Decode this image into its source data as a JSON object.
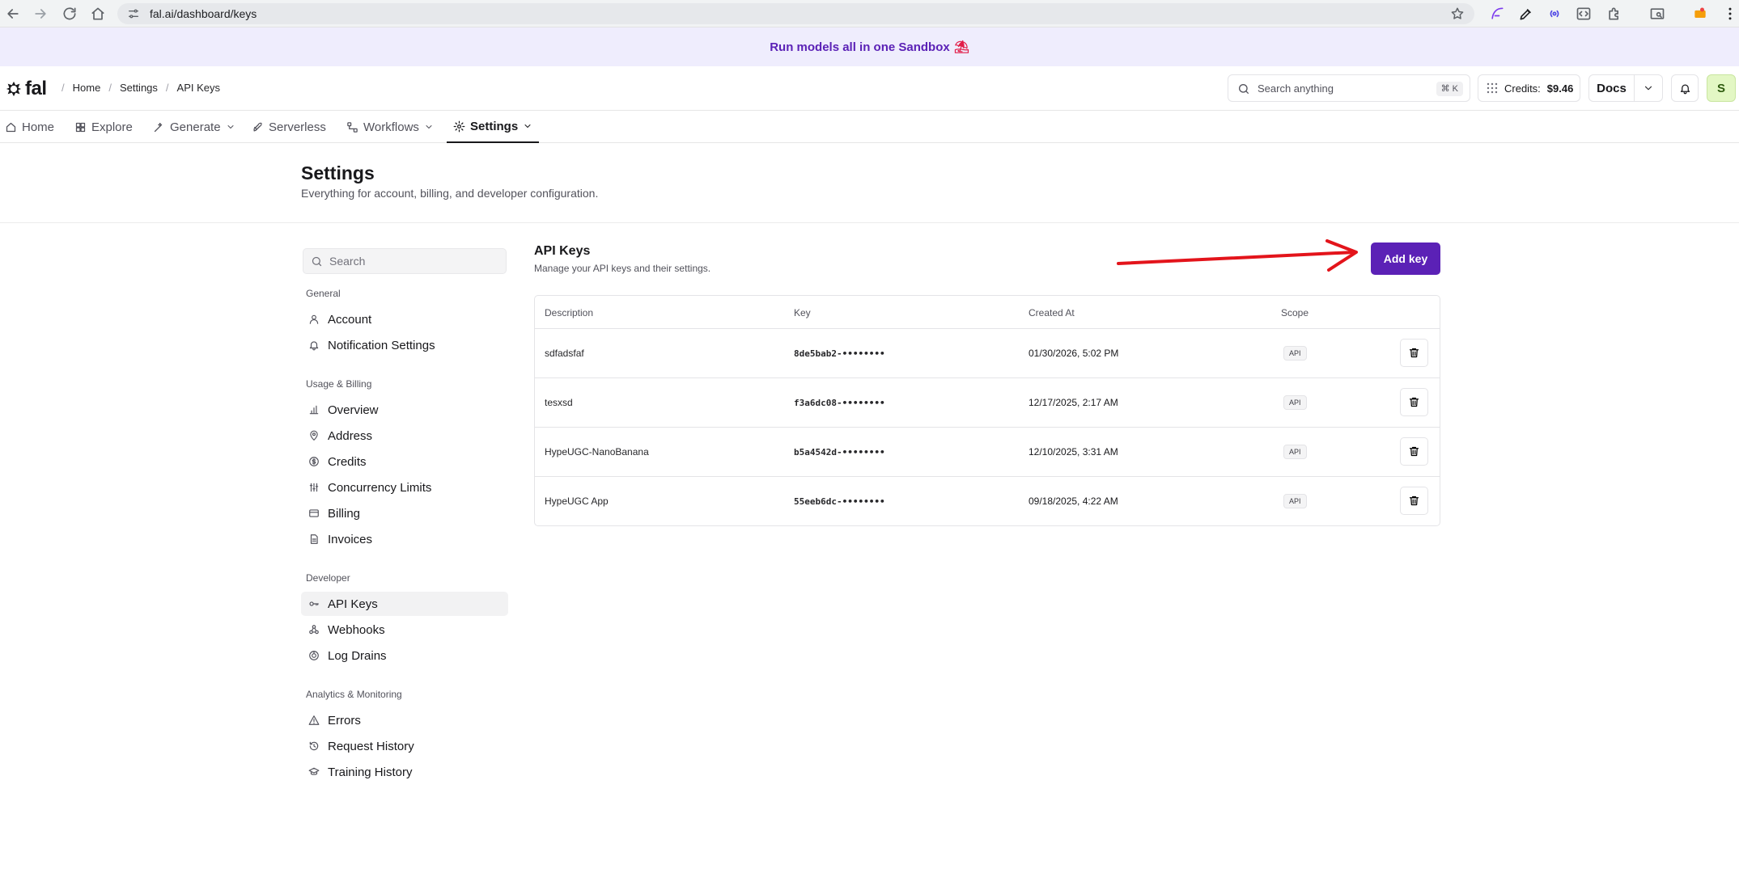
{
  "browser": {
    "url": "fal.ai/dashboard/keys"
  },
  "promo": {
    "text": "Run models all in one Sandbox",
    "emoji": "⛱"
  },
  "header": {
    "logo": "fal",
    "breadcrumb": [
      "Home",
      "Settings",
      "API Keys"
    ],
    "search_placeholder": "Search anything",
    "search_shortcut": "⌘ K",
    "credits_label": "Credits:",
    "credits_value": "$9.46",
    "docs_label": "Docs",
    "avatar_initial": "S"
  },
  "nav": {
    "items": [
      "Home",
      "Explore",
      "Generate",
      "Serverless",
      "Workflows",
      "Settings"
    ]
  },
  "page": {
    "title": "Settings",
    "subtitle": "Everything for account, billing, and developer configuration."
  },
  "sidebar": {
    "search_placeholder": "Search",
    "sections": [
      {
        "title": "General",
        "items": [
          "Account",
          "Notification Settings"
        ]
      },
      {
        "title": "Usage & Billing",
        "items": [
          "Overview",
          "Address",
          "Credits",
          "Concurrency Limits",
          "Billing",
          "Invoices"
        ]
      },
      {
        "title": "Developer",
        "items": [
          "API Keys",
          "Webhooks",
          "Log Drains"
        ]
      },
      {
        "title": "Analytics & Monitoring",
        "items": [
          "Errors",
          "Request History",
          "Training History"
        ]
      }
    ]
  },
  "api_keys": {
    "title": "API Keys",
    "subtitle": "Manage your API keys and their settings.",
    "add_button": "Add key",
    "columns": [
      "Description",
      "Key",
      "Created At",
      "Scope"
    ],
    "rows": [
      {
        "description": "sdfadsfaf",
        "key": "8de5bab2-••••••••",
        "created_at": "01/30/2026, 5:02 PM",
        "scope": "API"
      },
      {
        "description": "tesxsd",
        "key": "f3a6dc08-••••••••",
        "created_at": "12/17/2025, 2:17 AM",
        "scope": "API"
      },
      {
        "description": "HypeUGC-NanoBanana",
        "key": "b5a4542d-••••••••",
        "created_at": "12/10/2025, 3:31 AM",
        "scope": "API"
      },
      {
        "description": "HypeUGC App",
        "key": "55eeb6dc-••••••••",
        "created_at": "09/18/2025, 4:22 AM",
        "scope": "API"
      }
    ]
  },
  "colors": {
    "accent": "#5b21b6",
    "annotation_arrow": "#e3141b"
  }
}
